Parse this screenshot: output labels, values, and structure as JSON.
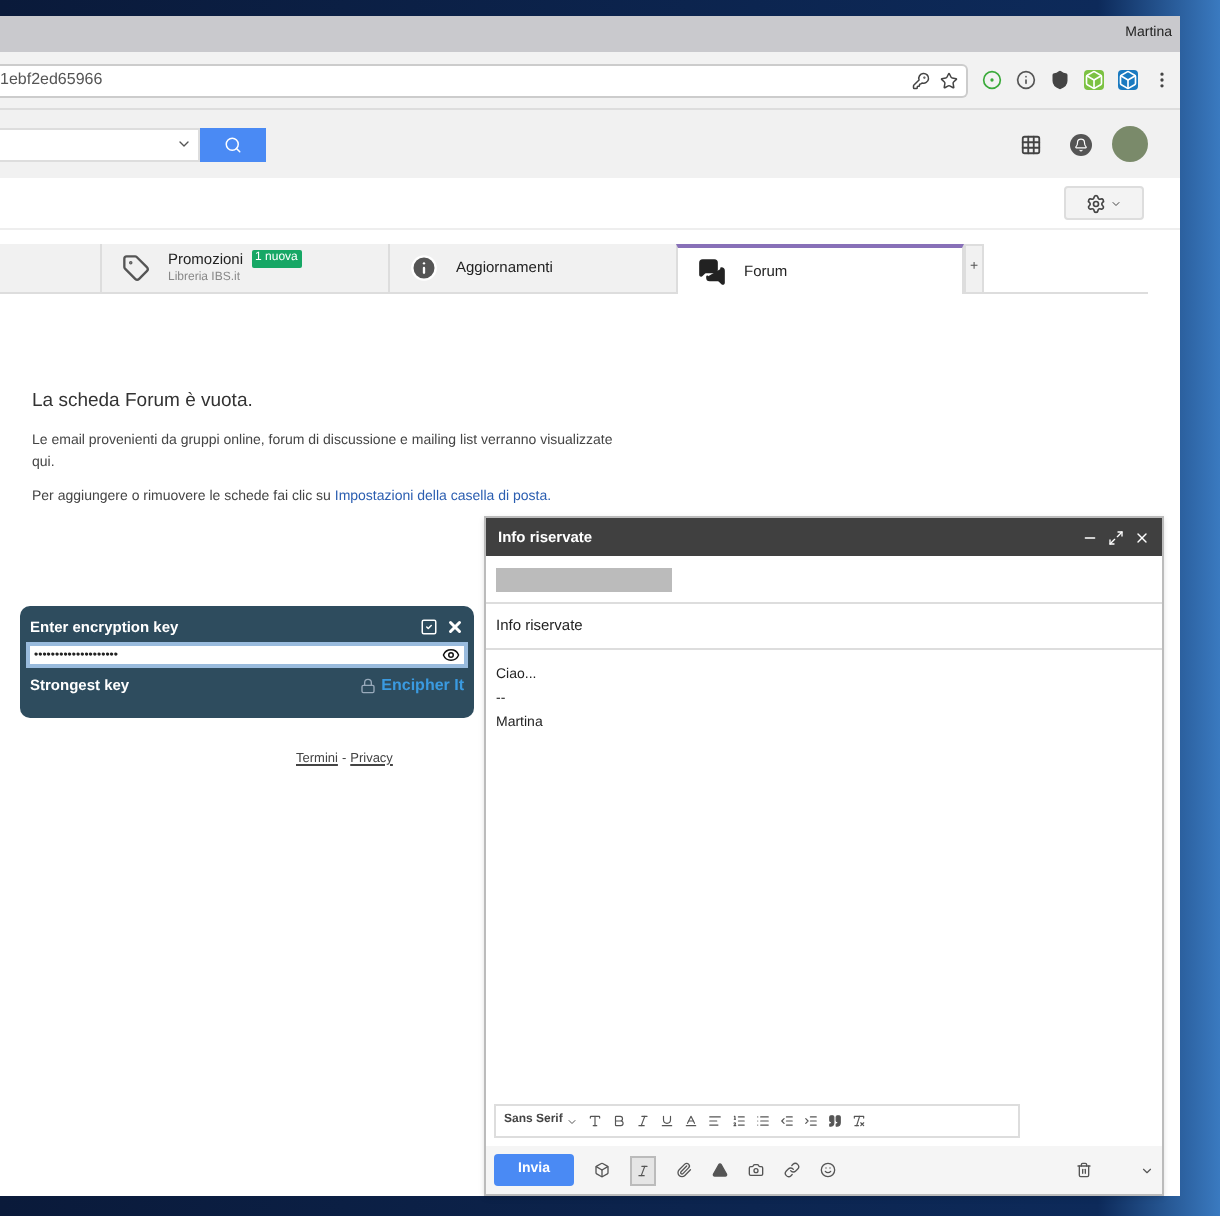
{
  "browser": {
    "profile": "Martina",
    "url": "1ebf2ed65966"
  },
  "tabs": [
    {
      "label": "Promozioni",
      "badge": "1 nuova",
      "subtitle": "Libreria IBS.it",
      "kind": "tag",
      "selected": false
    },
    {
      "label": "Aggiornamenti",
      "kind": "info",
      "selected": false
    },
    {
      "label": "Forum",
      "kind": "chat",
      "selected": true
    }
  ],
  "add_tab": "+",
  "empty": {
    "title": "La scheda Forum è vuota.",
    "text": "Le email provenienti da gruppi online, forum di discussione e mailing list verranno visualizzate qui.",
    "hint": "Per aggiungere o rimuovere le schede fai clic su",
    "link": "Impostazioni della casella di posta."
  },
  "footer": {
    "links": [
      "Termini",
      "Privacy"
    ],
    "separator": "-"
  },
  "encryption": {
    "title": "Enter encryption key",
    "value": "••••••••••••••••••••",
    "strength": "Strongest key",
    "action": "Encipher It"
  },
  "compose": {
    "title": "Info riservate",
    "subject": "Info riservate",
    "body": [
      "Ciao...",
      "--",
      "Martina"
    ],
    "font": "Sans Serif",
    "send": "Invia"
  }
}
